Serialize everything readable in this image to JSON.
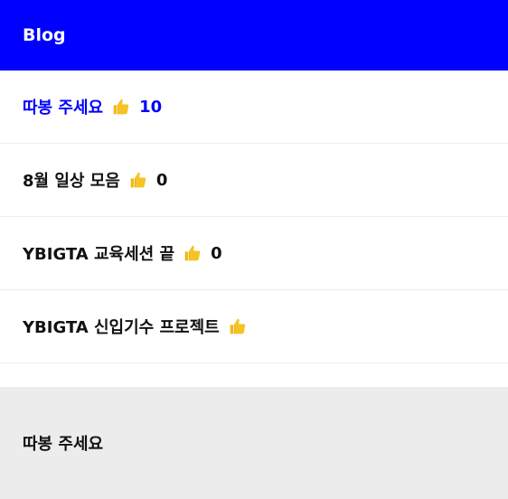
{
  "header": {
    "title": "Blog"
  },
  "posts": [
    {
      "title": "따봉 주세요",
      "likes": "10",
      "active": true
    },
    {
      "title": "8월 일상 모음",
      "likes": "0"
    },
    {
      "title": "YBIGTA 교육세션 끝",
      "likes": "0"
    },
    {
      "title": "YBIGTA 신입기수 프로젝트",
      "likes": ""
    }
  ],
  "detail": {
    "title": "따봉 주세요"
  },
  "icons": {
    "like": "thumbs-up-icon"
  },
  "colors": {
    "header_bg": "#0000ff",
    "accent": "#0000ff",
    "detail_bg": "#ececec"
  }
}
